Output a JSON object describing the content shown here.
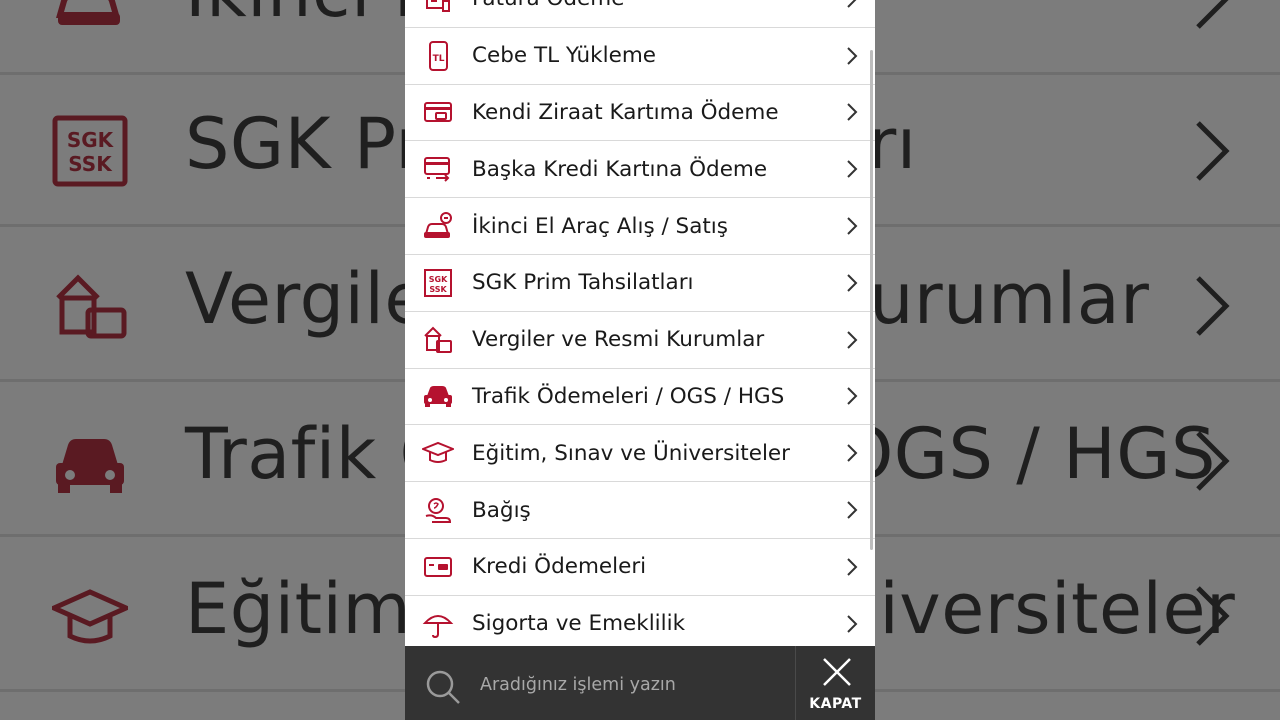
{
  "background": {
    "rows": [
      {
        "label": "İkinci El Araç Alış",
        "icon": "car-swap-icon"
      },
      {
        "label": "SGK Prim Tahsilatları",
        "icon": "sgk-ssk-icon"
      },
      {
        "label": "Vergiler ve Resmi Kurumlar",
        "icon": "government-building-icon"
      },
      {
        "label": "Trafik Ödemeleri / OGS / HGS",
        "icon": "car-icon"
      },
      {
        "label": "Eğitim, Sınav ve Üniversiteler",
        "icon": "graduation-cap-icon"
      }
    ]
  },
  "menu": {
    "items": [
      {
        "label": "Fatura Ödeme",
        "icon": "invoice-icon"
      },
      {
        "label": "Cebe TL Yükleme",
        "icon": "phone-tl-icon"
      },
      {
        "label": "Kendi Ziraat Kartıma Ödeme",
        "icon": "card-icon"
      },
      {
        "label": "Başka Kredi Kartına Ödeme",
        "icon": "card-transfer-icon"
      },
      {
        "label": "İkinci El Araç Alış / Satış",
        "icon": "car-swap-icon"
      },
      {
        "label": "SGK Prim Tahsilatları",
        "icon": "sgk-ssk-icon",
        "icon_text_top": "SGK",
        "icon_text_bottom": "SSK"
      },
      {
        "label": "Vergiler ve Resmi Kurumlar",
        "icon": "government-building-icon"
      },
      {
        "label": "Trafik Ödemeleri / OGS / HGS",
        "icon": "car-icon"
      },
      {
        "label": "Eğitim, Sınav ve Üniversiteler",
        "icon": "graduation-cap-icon"
      },
      {
        "label": "Bağış",
        "icon": "donation-hand-icon"
      },
      {
        "label": "Kredi Ödemeleri",
        "icon": "loan-card-icon"
      },
      {
        "label": "Sigorta ve Emeklilik",
        "icon": "umbrella-icon"
      }
    ]
  },
  "search": {
    "placeholder": "Aradığınız işlemi yazın",
    "value": ""
  },
  "close": {
    "label": "KAPAT"
  },
  "colors": {
    "accent": "#b5122f",
    "bottom_bar": "#333333",
    "background_dim": "#7c7c7c"
  }
}
